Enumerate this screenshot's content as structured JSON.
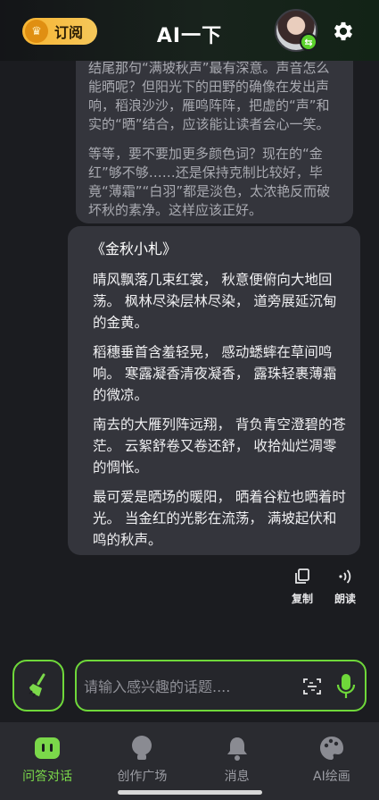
{
  "header": {
    "subscribe_label": "订阅",
    "title": "AI一下",
    "avatar_icon": "user-avatar",
    "settings_icon": "gear-icon"
  },
  "thinking": {
    "paragraphs": [
      "结尾那句“满坡秋声”最有深意。声音怎么能晒呢？但阳光下的田野的确像在发出声响，稻浪沙沙，雁鸣阵阵，把虚的“声”和实的“晒”结合，应该能让读者会心一笑。",
      "等等，要不要加更多颜色词？现在的“金红”够不够……还是保持克制比较好，毕竟“薄霜”“白羽”都是淡色，太浓艳反而破坏秋的素净。这样应该正好。"
    ]
  },
  "answer": {
    "title": "《金秋小札》",
    "paragraphs": [
      "晴风飘落几束红裳， 秋意便俯向大地回荡。 枫林尽染层林尽染， 道旁展延沉甸的金黄。",
      "稻穗垂首含羞轻晃， 感动蟋蟀在草间鸣响。 寒露凝香清夜凝香， 露珠轻裹薄霜的微凉。",
      "南去的大雁列阵远翔， 背负青空澄碧的苍茫。 云絮舒卷又卷还舒， 收拾灿烂凋零的惆怅。",
      "最可爱是晒场的暖阳， 晒着谷粒也晒着时光。 当金红的光影在流荡， 满坡起伏和鸣的秋声。"
    ]
  },
  "actions": {
    "copy_label": "复制",
    "read_label": "朗读"
  },
  "input": {
    "placeholder": "请输入感兴趣的话题...."
  },
  "nav": {
    "items": [
      {
        "label": "问答对话",
        "icon": "chat-icon",
        "active": true
      },
      {
        "label": "创作广场",
        "icon": "lightbulb-icon",
        "active": false
      },
      {
        "label": "消息",
        "icon": "bell-icon",
        "active": false
      },
      {
        "label": "AI绘画",
        "icon": "palette-icon",
        "active": false
      }
    ]
  },
  "colors": {
    "accent": "#6fd83a",
    "background": "#1b1c20",
    "card": "#34353c",
    "subscribe": "#f7b533"
  }
}
